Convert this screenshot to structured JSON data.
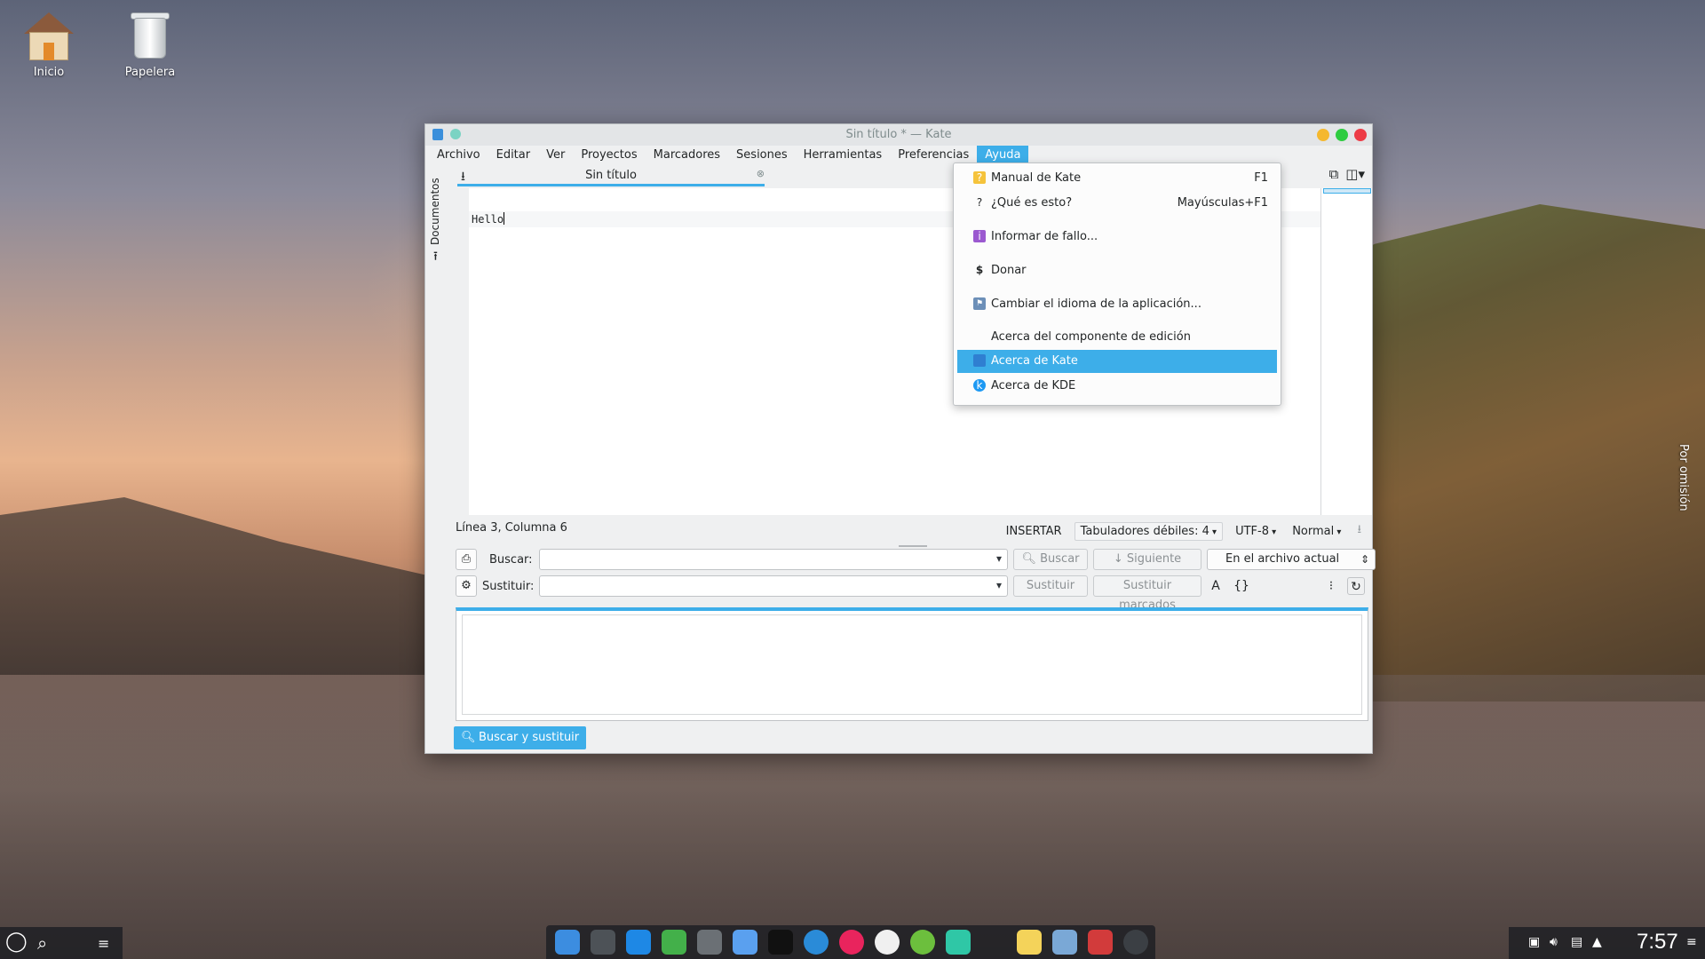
{
  "desktop": {
    "icons": [
      {
        "label": "Inicio"
      },
      {
        "label": "Papelera"
      }
    ],
    "side_label": "Por omisión"
  },
  "window": {
    "title": "Sin título * — Kate",
    "menu": [
      "Archivo",
      "Editar",
      "Ver",
      "Proyectos",
      "Marcadores",
      "Sesiones",
      "Herramientas",
      "Preferencias",
      "Ayuda"
    ],
    "sidebar_label": "Documentos",
    "tab_label": "Sin título",
    "editor_text": "Hello"
  },
  "status": {
    "position": "Línea 3, Columna 6",
    "mode": "INSERTAR",
    "indent": "Tabuladores débiles: 4",
    "encoding": "UTF-8",
    "highlight": "Normal"
  },
  "search": {
    "find_label": "Buscar:",
    "replace_label": "Sustituir:",
    "find_button": "Buscar",
    "next_button": "Siguiente",
    "scope": "En el archivo actual",
    "replace_button": "Sustituir",
    "replace_checked_button": "Sustituir marcados",
    "panel_tab": "Buscar y sustituir"
  },
  "help_menu": {
    "items": [
      {
        "label": "Manual de Kate",
        "shortcut": "F1",
        "icon": "kate-manual-icon",
        "color": "#f5c33b"
      },
      {
        "label": "¿Qué es esto?",
        "shortcut": "Mayúsculas+F1",
        "icon": "question-icon",
        "color": ""
      },
      {
        "label": "Informar de fallo...",
        "shortcut": "",
        "icon": "bug-report-icon",
        "color": "#9b59d0"
      },
      {
        "label": "Donar",
        "shortcut": "",
        "icon": "dollar-icon",
        "color": ""
      },
      {
        "label": "Cambiar el idioma de la aplicación...",
        "shortcut": "",
        "icon": "language-flag-icon",
        "color": "#6c8fb8"
      },
      {
        "label": "Acerca del componente de edición",
        "shortcut": "",
        "icon": "",
        "color": ""
      },
      {
        "label": "Acerca de Kate",
        "shortcut": "",
        "icon": "kate-icon",
        "color": "#2f7fd1"
      },
      {
        "label": "Acerca de KDE",
        "shortcut": "",
        "icon": "kde-icon",
        "color": "#1d99f3"
      }
    ]
  },
  "taskbar": {
    "clock": "7:57",
    "accent": "#3daee9"
  }
}
